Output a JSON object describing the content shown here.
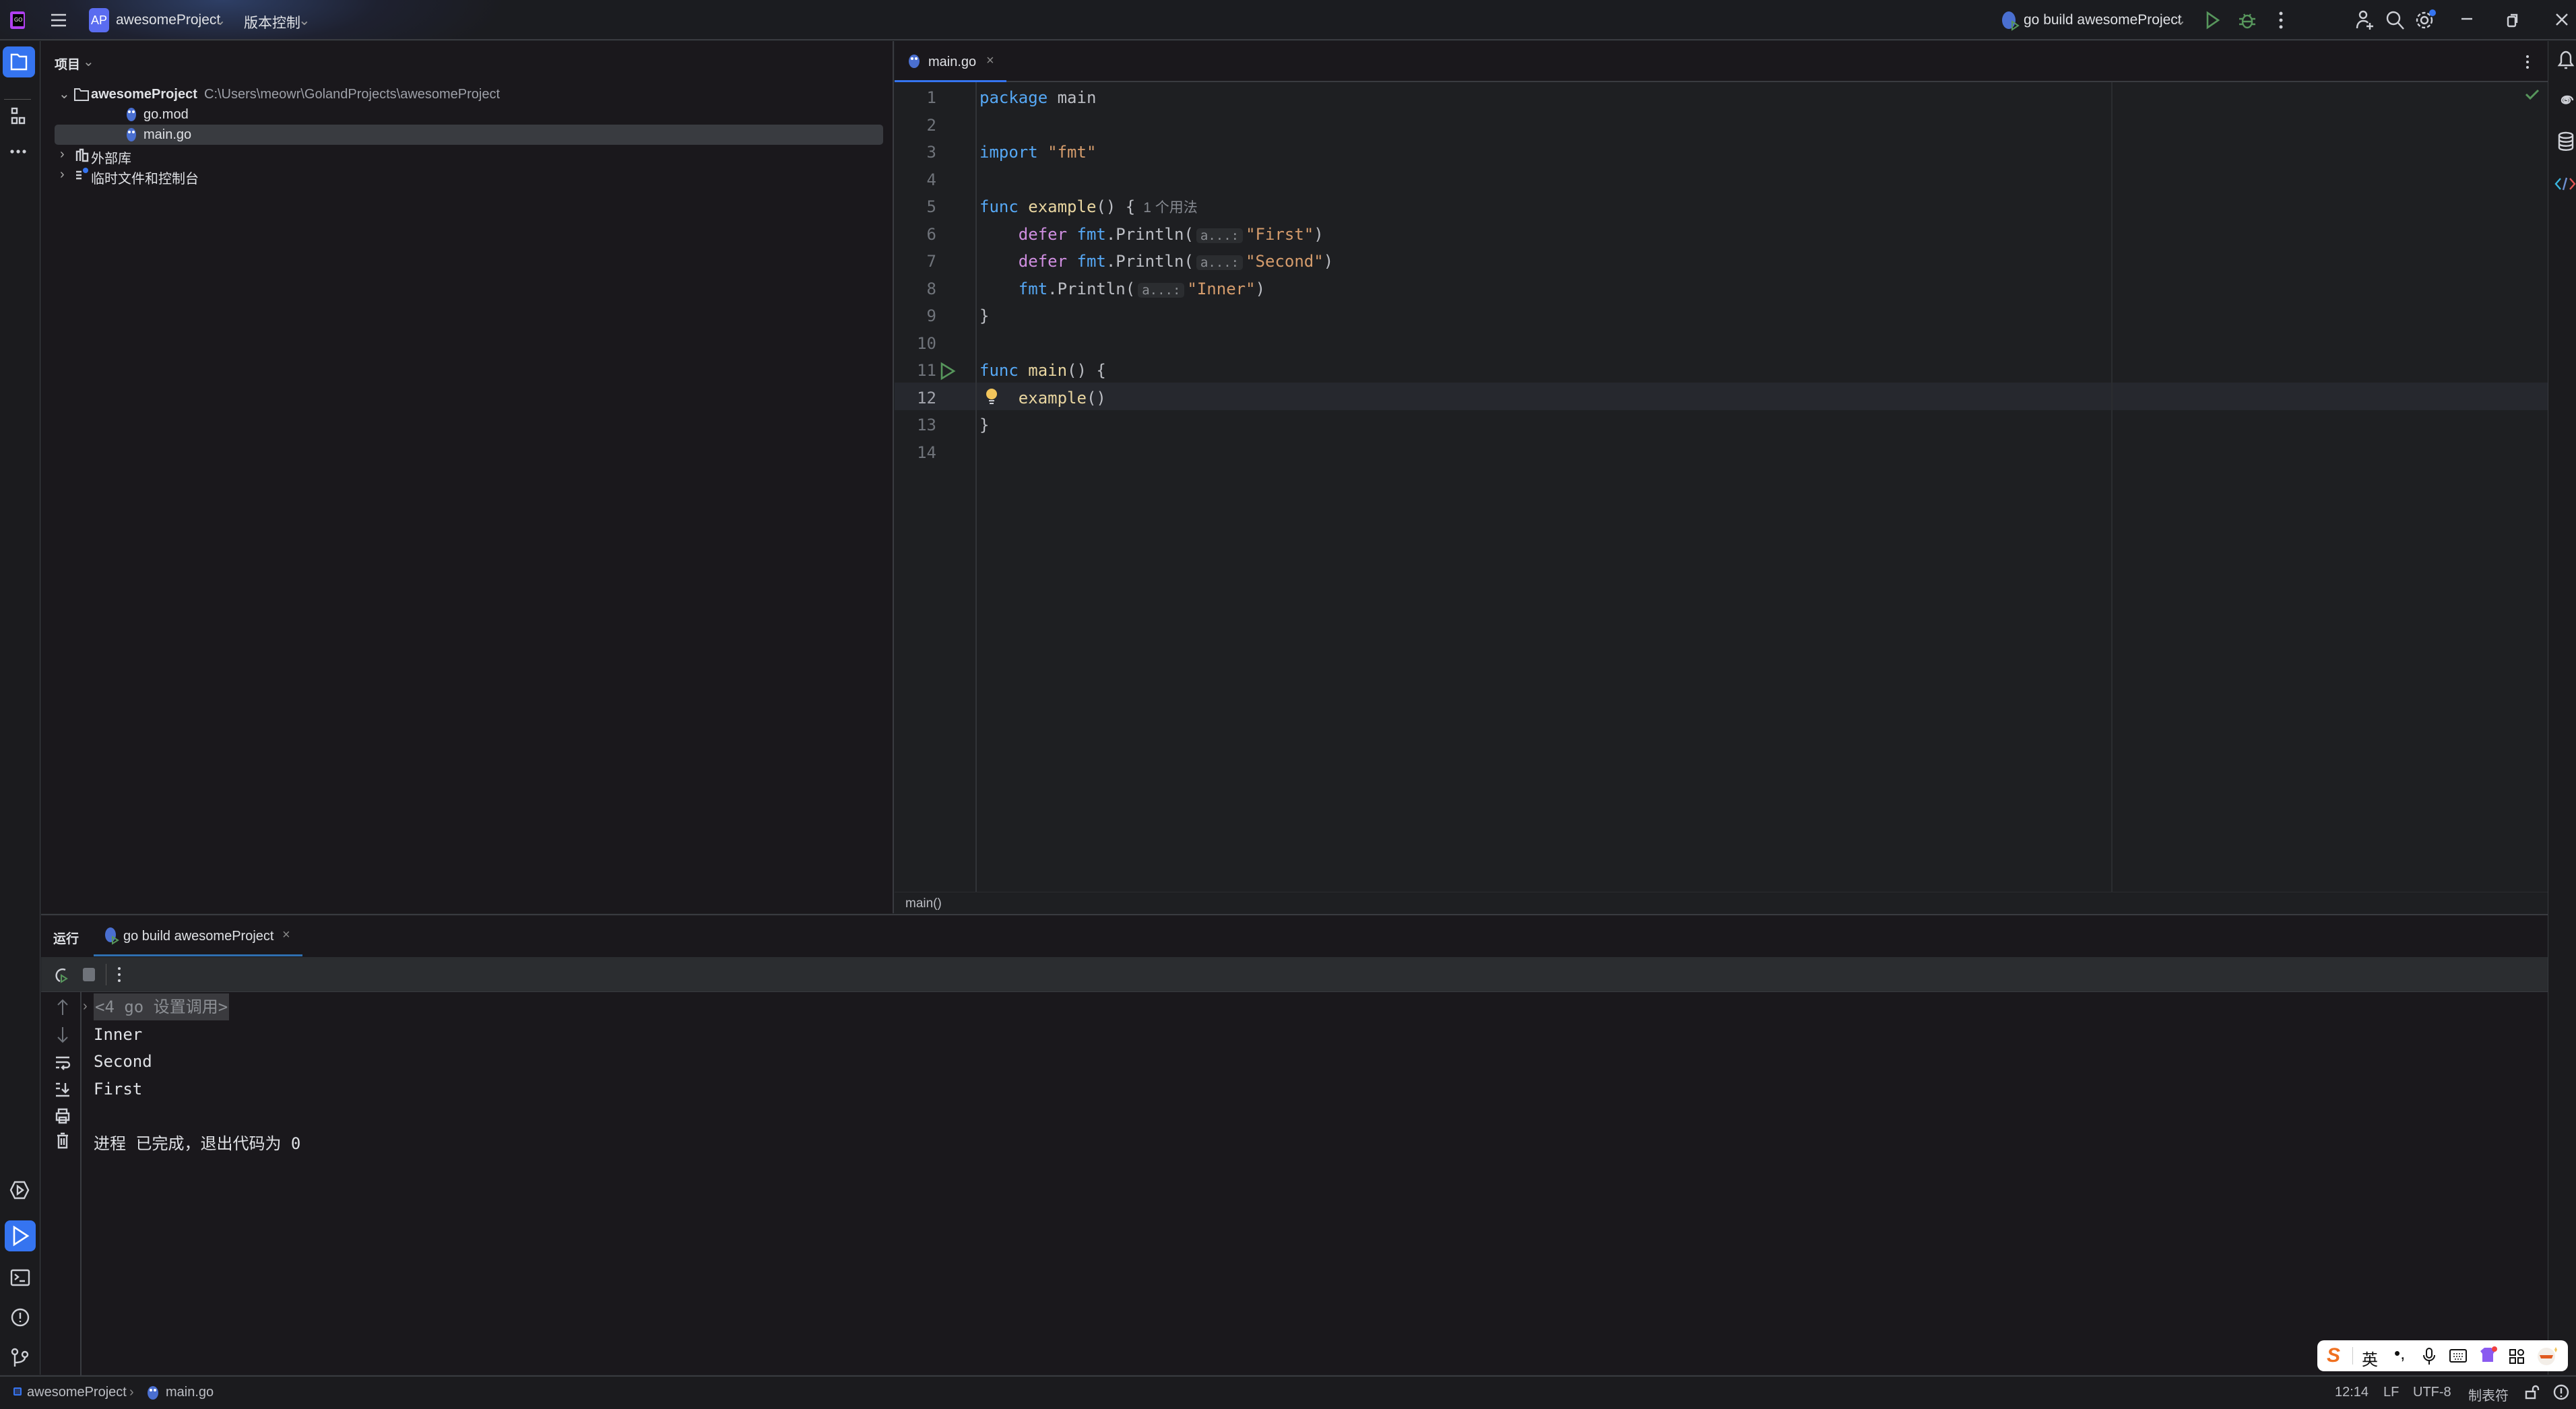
{
  "titlebar": {
    "project_badge": "AP",
    "project_name": "awesomeProject",
    "vcs": "版本控制",
    "run_config": "go build awesomeProject"
  },
  "project_panel": {
    "title": "项目",
    "tree": [
      {
        "label": "awesomeProject",
        "path": "C:\\Users\\meowr\\GolandProjects\\awesomeProject"
      },
      {
        "label": "go.mod"
      },
      {
        "label": "main.go",
        "selected": true
      },
      {
        "label": "外部库"
      },
      {
        "label": "临时文件和控制台"
      }
    ]
  },
  "editor": {
    "tab": "main.go",
    "breadcrumb": "main()",
    "usage_hint": "1 个用法",
    "param_hint": "a...:",
    "line_numbers": [
      "1",
      "2",
      "3",
      "4",
      "5",
      "6",
      "7",
      "8",
      "9",
      "10",
      "11",
      "12",
      "13",
      "14"
    ],
    "lines": [
      [
        [
          "kw",
          "package"
        ],
        [
          "plain",
          " main"
        ]
      ],
      [],
      [
        [
          "kw",
          "import"
        ],
        [
          "plain",
          " "
        ],
        [
          "str",
          "\"fmt\""
        ]
      ],
      [],
      [
        [
          "kw",
          "func"
        ],
        [
          "plain",
          " "
        ],
        [
          "fn",
          "example"
        ],
        [
          "plain",
          "() {"
        ]
      ],
      [
        [
          "plain",
          "    "
        ],
        [
          "kw2",
          "defer"
        ],
        [
          "plain",
          " "
        ],
        [
          "pkg",
          "fmt"
        ],
        [
          "plain",
          ".Println("
        ],
        [
          "hint",
          ""
        ],
        [
          "str",
          "\"First\""
        ],
        [
          "plain",
          ")"
        ]
      ],
      [
        [
          "plain",
          "    "
        ],
        [
          "kw2",
          "defer"
        ],
        [
          "plain",
          " "
        ],
        [
          "pkg",
          "fmt"
        ],
        [
          "plain",
          ".Println("
        ],
        [
          "hint",
          ""
        ],
        [
          "str",
          "\"Second\""
        ],
        [
          "plain",
          ")"
        ]
      ],
      [
        [
          "plain",
          "    "
        ],
        [
          "pkg",
          "fmt"
        ],
        [
          "plain",
          ".Println("
        ],
        [
          "hint",
          ""
        ],
        [
          "str",
          "\"Inner\""
        ],
        [
          "plain",
          ")"
        ]
      ],
      [
        [
          "plain",
          "}"
        ]
      ],
      [],
      [
        [
          "kw",
          "func"
        ],
        [
          "plain",
          " "
        ],
        [
          "fn",
          "main"
        ],
        [
          "plain",
          "() {"
        ]
      ],
      [
        [
          "plain",
          "    "
        ],
        [
          "fn",
          "example"
        ],
        [
          "plain",
          "()"
        ]
      ],
      [
        [
          "plain",
          "}"
        ]
      ],
      []
    ]
  },
  "run_panel": {
    "title": "运行",
    "tab": "go build awesomeProject",
    "output": [
      "<4 go 设置调用>",
      "Inner",
      "Second",
      "First",
      "",
      "进程 已完成，退出代码为 0"
    ]
  },
  "statusbar": {
    "project": "awesomeProject",
    "file": "main.go",
    "position": "12:14",
    "line_sep": "LF",
    "encoding": "UTF-8",
    "indent": "制表符"
  },
  "ime": {
    "mode": "英"
  },
  "colors": {
    "accent": "#3574f0",
    "run_green": "#57965c"
  }
}
